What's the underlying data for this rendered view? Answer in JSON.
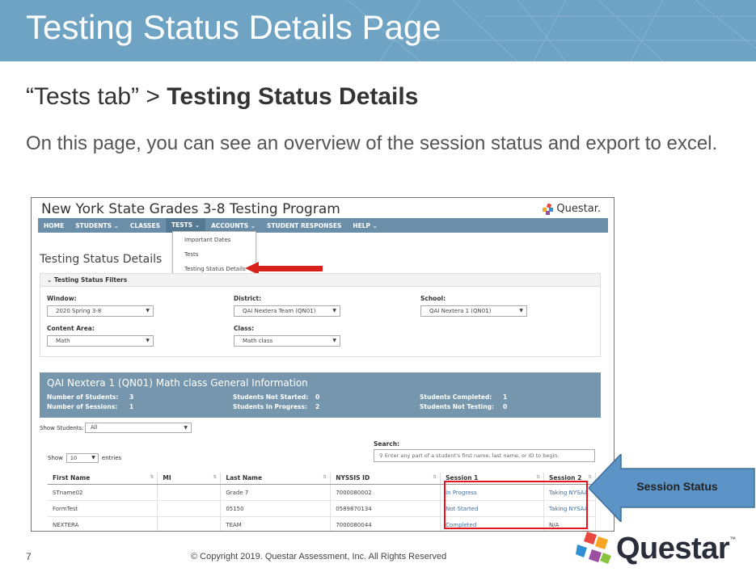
{
  "slide": {
    "title": "Testing Status Details Page",
    "breadcrumb_prefix": "“Tests tab” > ",
    "breadcrumb_bold": "Testing Status Details",
    "description": "On this page, you can see an overview of the session status and export to excel.",
    "page_number": "7",
    "copyright": "© Copyright 2019.  Questar Assessment, Inc. All Rights Reserved",
    "logo_text": "Questar",
    "logo_tm": "™",
    "callout": "Session Status"
  },
  "app": {
    "title": "New York State Grades 3-8 Testing Program",
    "logo": "Questar.",
    "nav": [
      "HOME",
      "STUDENTS ⌄",
      "CLASSES",
      "TESTS ⌄",
      "ACCOUNTS ⌄",
      "STUDENT RESPONSES",
      "HELP ⌄"
    ],
    "dropdown": [
      "Important Dates",
      "Tests",
      "Testing Status Details"
    ],
    "page_heading": "Testing Status Details",
    "filters": {
      "header": "⌄  Testing Status Filters",
      "window_label": "Window:",
      "window_value": "2020 Spring 3-8",
      "district_label": "District:",
      "district_value": "QAI Nextera Team (QN01)",
      "school_label": "School:",
      "school_value": "QAI Nextera 1 (QN01)",
      "content_label": "Content Area:",
      "content_value": "Math",
      "class_label": "Class:",
      "class_value": "Math class"
    },
    "info": {
      "title": "QAI Nextera 1 (QN01) Math class General Information",
      "num_students_label": "Number of Students:",
      "num_students": "3",
      "num_sessions_label": "Number of Sessions:",
      "num_sessions": "1",
      "not_started_label": "Students Not Started:",
      "not_started": "0",
      "in_progress_label": "Students In Progress:",
      "in_progress": "2",
      "completed_label": "Students Completed:",
      "completed": "1",
      "not_testing_label": "Students Not Testing:",
      "not_testing": "0"
    },
    "show_students_label": "Show Students:",
    "show_students_value": "All",
    "search_label": "Search:",
    "search_placeholder": "Enter any part of a student's first name, last name, or ID to begin.",
    "show_label": "Show",
    "show_value": "10",
    "entries_label": "entries",
    "table": {
      "headers": [
        "First Name",
        "MI",
        "Last Name",
        "NYSSIS ID",
        "Session 1",
        "Session 2"
      ],
      "rows": [
        [
          "STname02",
          "",
          "Grade 7",
          "7000080002",
          "In Progress",
          "Taking NYSAA"
        ],
        [
          "FormTest",
          "",
          "05150",
          "0589870134",
          "Not Started",
          "Taking NYSAA"
        ],
        [
          "NEXTERA",
          "",
          "TEAM",
          "7000080044",
          "Completed",
          "N/A"
        ]
      ]
    }
  },
  "colors": {
    "banner": "#6ea3c4",
    "navbar": "#6b8fa8",
    "info_panel": "#7596ad",
    "highlight_red": "#e3141b",
    "callout_blue": "#5c94c7"
  }
}
